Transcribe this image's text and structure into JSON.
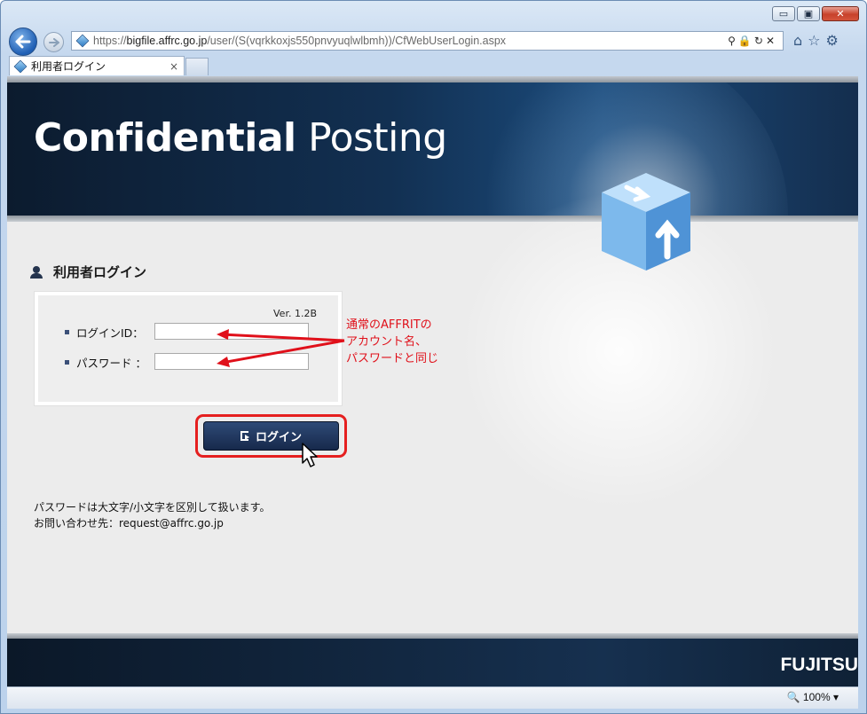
{
  "browser": {
    "address": {
      "scheme": "https://",
      "host": "bigfile.affrc.go.jp",
      "path": "/user/(S(vqrkkoxjs550pnvyuqlwlbmh))/CfWebUserLogin.aspx"
    },
    "tab_title": "利用者ログイン",
    "tab_close": "×",
    "zoom": "100%",
    "window_controls": {
      "minimize": "▭",
      "restore": "▣",
      "close": "✕"
    }
  },
  "banner": {
    "title_bold": "Confidential",
    "title_light": "Posting"
  },
  "login": {
    "heading": "利用者ログイン",
    "version": "Ver. 1.2B",
    "id_label": "ログインID：",
    "password_label": "パスワード ：",
    "id_value": "",
    "password_value": "",
    "button_label": "ログイン"
  },
  "annotation": {
    "line1": "通常のAFFRITの",
    "line2": "アカウント名、",
    "line3": "パスワードと同じ",
    "color": "#e0101a"
  },
  "notes": {
    "line1": "パスワードは大文字/小文字を区別して扱います。",
    "line2": "お問い合わせ先：request@affrc.go.jp"
  },
  "footer": {
    "brand": "FUJITSU"
  },
  "colors": {
    "banner_dark": "#0c1b2e",
    "button_dark": "#16284a",
    "highlight_red": "#e51f1f"
  }
}
